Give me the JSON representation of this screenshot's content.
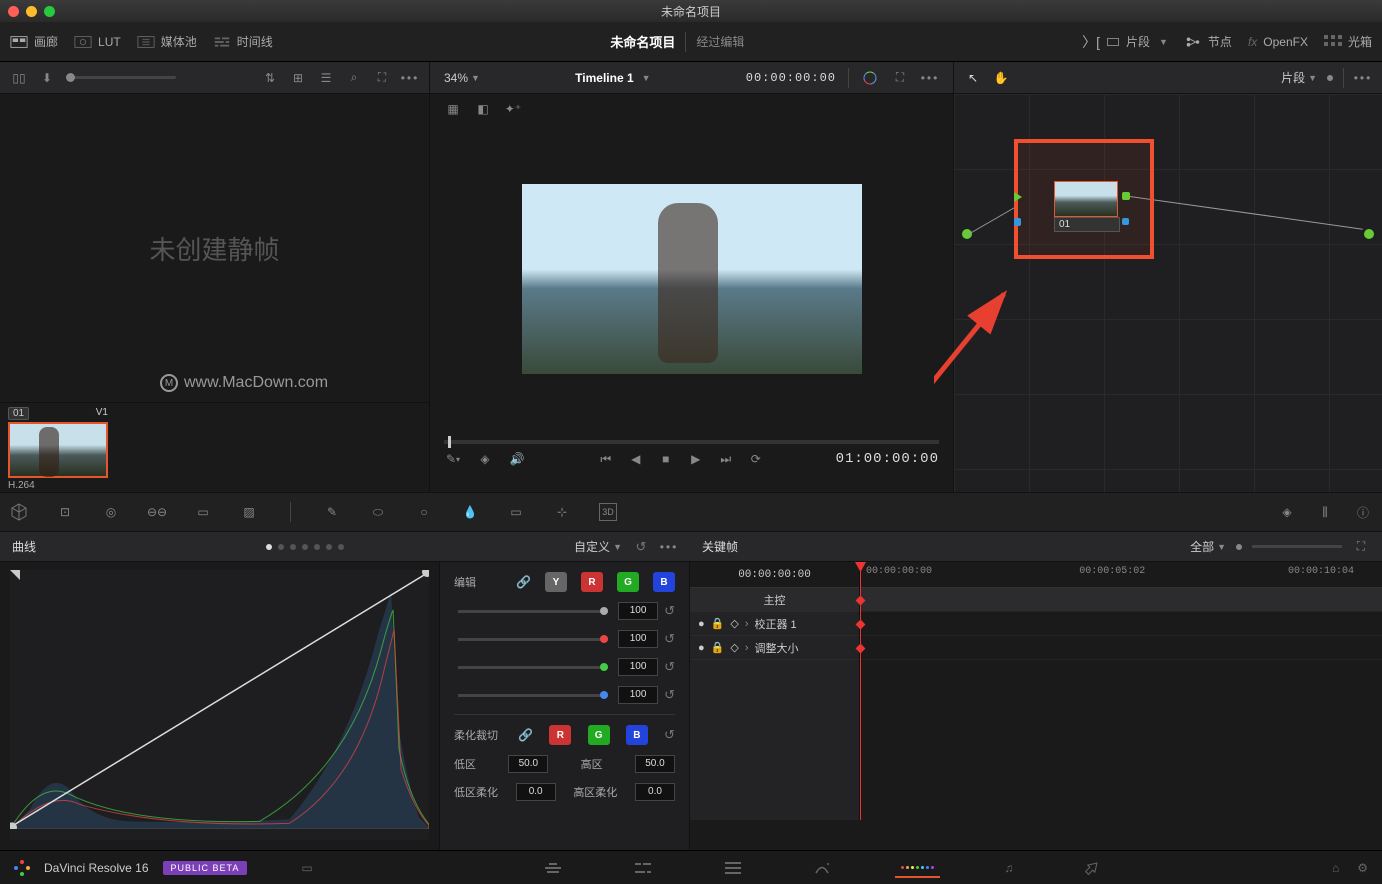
{
  "window": {
    "title": "未命名项目"
  },
  "topbar": {
    "left": {
      "gallery": "画廊",
      "lut": "LUT",
      "mediapool": "媒体池",
      "timeline": "时间线"
    },
    "center": {
      "project": "未命名项目",
      "status": "经过编辑"
    },
    "right": {
      "clips": "片段",
      "nodes": "节点",
      "openfx": "OpenFX",
      "lightbox": "光箱"
    }
  },
  "row2": {
    "zoom": "34%",
    "timeline_name": "Timeline 1",
    "tc": "00:00:00:00",
    "right_label": "片段"
  },
  "gallery": {
    "empty": "未创建静帧"
  },
  "viewer": {
    "tc": "01:00:00:00"
  },
  "clip": {
    "badge": "01",
    "track": "V1",
    "codec": "H.264"
  },
  "node": {
    "label": "01"
  },
  "watermark": {
    "text": "www.MacDown.com"
  },
  "curves": {
    "title": "曲线",
    "mode": "自定义",
    "edit": "编辑",
    "soft": "柔化裁切",
    "vals": {
      "y": "100",
      "r": "100",
      "g": "100",
      "b": "100"
    },
    "low": "低区",
    "high": "高区",
    "low_soft": "低区柔化",
    "high_soft": "高区柔化",
    "val50": "50.0",
    "val0": "0.0"
  },
  "keyframes": {
    "title": "关键帧",
    "all": "全部",
    "tc": "00:00:00:00",
    "master": "主控",
    "t1": "校正器 1",
    "t2": "调整大小",
    "ruler": [
      "00:00:00:00",
      "00:00:05:02",
      "00:00:10:04"
    ]
  },
  "pagebar": {
    "app": "DaVinci Resolve 16",
    "beta": "PUBLIC BETA"
  }
}
